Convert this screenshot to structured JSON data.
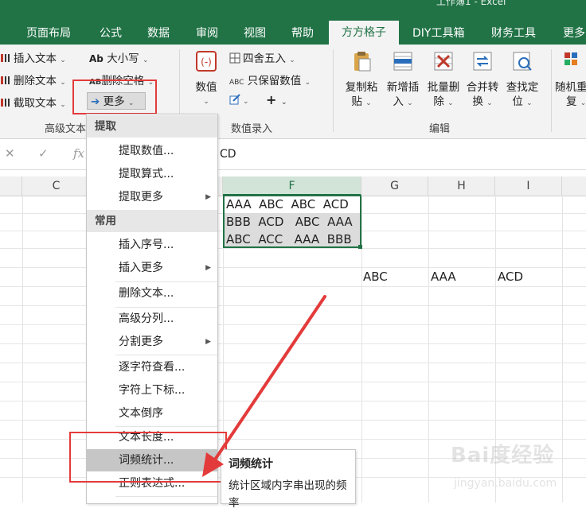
{
  "title": "工作簿1 - Excel",
  "tabs": [
    "页面布局",
    "公式",
    "数据",
    "审阅",
    "视图",
    "帮助",
    "方方格子",
    "DIY工具箱",
    "财务工具",
    "更多"
  ],
  "active_tab": "方方格子",
  "ribbon": {
    "text_group": {
      "insert_text": "插入文本",
      "delete_text": "删除文本",
      "extract_text": "截取文本",
      "case": "大小写",
      "case_icon": "Ab",
      "delete_space": "删除空格",
      "delete_space_icon": "AB",
      "more": "更多",
      "group_name": "高级文本"
    },
    "value_group": {
      "value_button": "数值",
      "round": "四舍五入",
      "keep_value": "只保留数值",
      "keep_value_icon": "ABC",
      "plus": "+",
      "group_name": "数值录入"
    },
    "edit_group": {
      "copy_paste": [
        "复制粘",
        "贴"
      ],
      "new_insert": [
        "新增插",
        "入"
      ],
      "batch_delete": [
        "批量删",
        "除"
      ],
      "merge_convert": [
        "合并转",
        "换"
      ],
      "find_locate": [
        "查找定",
        "位"
      ],
      "group_name": "编辑"
    },
    "random_group": {
      "random_repeat": [
        "随机重",
        "复"
      ]
    }
  },
  "formula_bar": {
    "cancel": "✕",
    "confirm": "✓",
    "fx": "fx",
    "value": "CD"
  },
  "grid": {
    "columns": [
      "C",
      "F",
      "G",
      "H",
      "I"
    ],
    "selected_column": "F",
    "f_cells": [
      [
        "AAA",
        "ABC",
        "ABC",
        "ACD"
      ],
      [
        "BBB",
        "ACD",
        "ABC",
        "AAA"
      ],
      [
        "ABC",
        "ACC",
        "AAA",
        "BBB"
      ]
    ],
    "row5": {
      "G": "ABC",
      "H": "AAA",
      "I": "ACD"
    }
  },
  "menu": {
    "sections": [
      {
        "header": "提取",
        "items": [
          {
            "label": "提取数值...",
            "submenu": false
          },
          {
            "label": "提取算式...",
            "submenu": false
          },
          {
            "label": "提取更多",
            "submenu": true
          }
        ]
      },
      {
        "header": "常用",
        "items": [
          {
            "label": "插入序号...",
            "submenu": false
          },
          {
            "label": "插入更多",
            "submenu": true
          },
          {
            "label": "删除文本...",
            "submenu": false
          },
          {
            "label": "高级分列...",
            "submenu": false
          },
          {
            "label": "分割更多",
            "submenu": true
          },
          {
            "label": "逐字符查看...",
            "submenu": false
          },
          {
            "label": "字符上下标...",
            "submenu": false
          },
          {
            "label": "文本倒序",
            "submenu": false
          },
          {
            "label": "文本长度...",
            "submenu": false
          },
          {
            "label": "词频统计...",
            "submenu": false,
            "highlighted": true
          },
          {
            "label": "正则表达式...",
            "submenu": false
          }
        ]
      }
    ]
  },
  "tooltip": {
    "title": "词频统计",
    "description": "统计区域内字串出现的频率"
  },
  "watermark": {
    "line1": "Bai度经验",
    "line2": "jingyan.baidu.com"
  },
  "colors": {
    "excel_green": "#217346",
    "highlight_red": "#e33b3b",
    "menu_highlight": "#c6c6c6"
  }
}
